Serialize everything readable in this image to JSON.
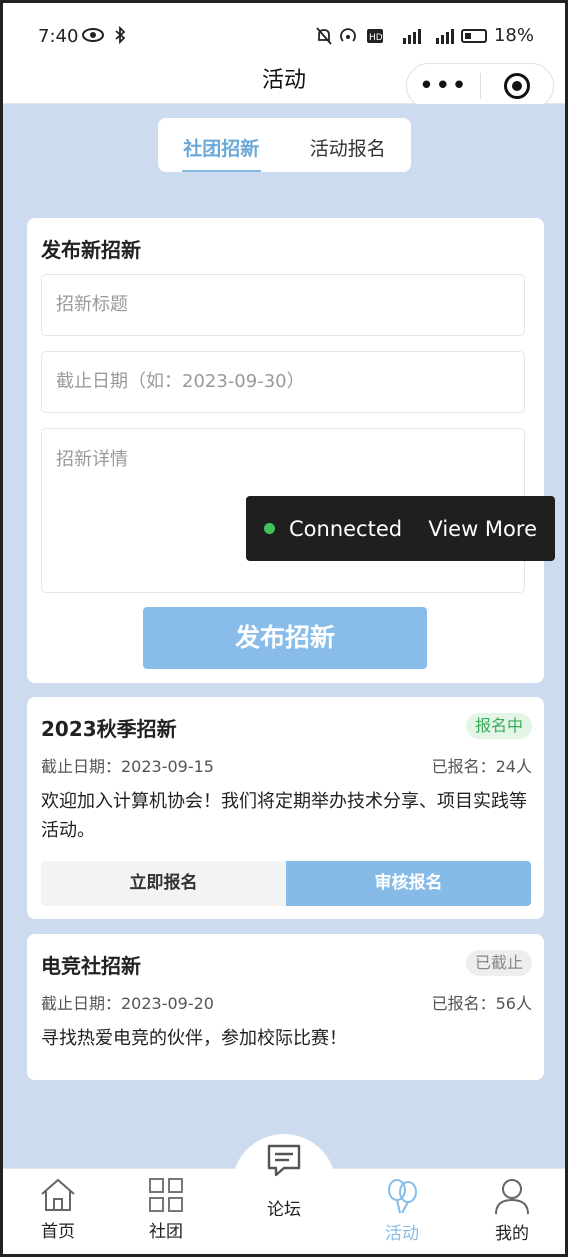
{
  "status_bar": {
    "time": "7:40",
    "battery": "18%"
  },
  "nav": {
    "title": "活动"
  },
  "tabs": [
    {
      "label": "社团招新",
      "active": true
    },
    {
      "label": "活动报名",
      "active": false
    }
  ],
  "form": {
    "title": "发布新招新",
    "title_placeholder": "招新标题",
    "date_placeholder": "截止日期（如：2023-09-30）",
    "detail_placeholder": "招新详情",
    "submit_label": "发布招新"
  },
  "recruitments": [
    {
      "title": "2023秋季招新",
      "status": "报名中",
      "deadline": "截止日期：2023-09-15",
      "signed": "已报名：24人",
      "description": "欢迎加入计算机协会！我们将定期举办技术分享、项目实践等活动。",
      "action_apply": "立即报名",
      "action_review": "审核报名"
    },
    {
      "title": "电竞社招新",
      "status": "已截止",
      "deadline": "截止日期：2023-09-20",
      "signed": "已报名：56人",
      "description": "寻找热爱电竞的伙伴，参加校际比赛！"
    }
  ],
  "toast": {
    "status": "Connected",
    "link": "View More",
    "dot_color": "#3fc35a"
  },
  "tabbar": [
    {
      "label": "首页",
      "icon": "home-icon"
    },
    {
      "label": "社团",
      "icon": "grid-icon"
    },
    {
      "label": "论坛",
      "icon": "chat-icon"
    },
    {
      "label": "活动",
      "icon": "balloon-icon",
      "active": true
    },
    {
      "label": "我的",
      "icon": "user-icon"
    }
  ],
  "colors": {
    "accent": "#86bbe7",
    "background": "#ccdcee",
    "badge_active": "#3bab5a"
  }
}
